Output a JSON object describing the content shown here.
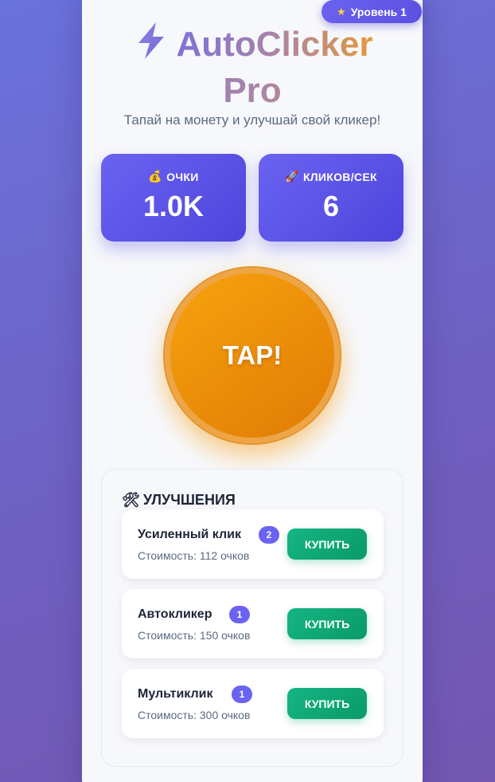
{
  "header": {
    "level_label": "Уровень 1",
    "title_line1": "AutoClicker",
    "title_line2": "Pro",
    "subtitle": "Тапай на монету и улучшай свой кликер!"
  },
  "stats": [
    {
      "icon": "money-bag-icon",
      "label": "ОЧКИ",
      "value": "1.0K"
    },
    {
      "icon": "rocket-icon",
      "label": "КЛИКОВ/СЕК",
      "value": "6"
    }
  ],
  "coin": {
    "label": "TAP!"
  },
  "upgrades": {
    "heading": "УЛУЧШЕНИЯ",
    "items": [
      {
        "name": "Усиленный клик",
        "count": "2",
        "cost": "Стоимость: 112 очков",
        "buy_label": "КУПИТЬ"
      },
      {
        "name": "Автокликер",
        "count": "1",
        "cost": "Стоимость: 150 очков",
        "buy_label": "КУПИТЬ"
      },
      {
        "name": "Мультиклик",
        "count": "1",
        "cost": "Стоимость: 300 очков",
        "buy_label": "КУПИТЬ"
      }
    ]
  },
  "colors": {
    "accent": "#6a63f1",
    "coin": "#f39c12",
    "buy": "#10b981"
  }
}
